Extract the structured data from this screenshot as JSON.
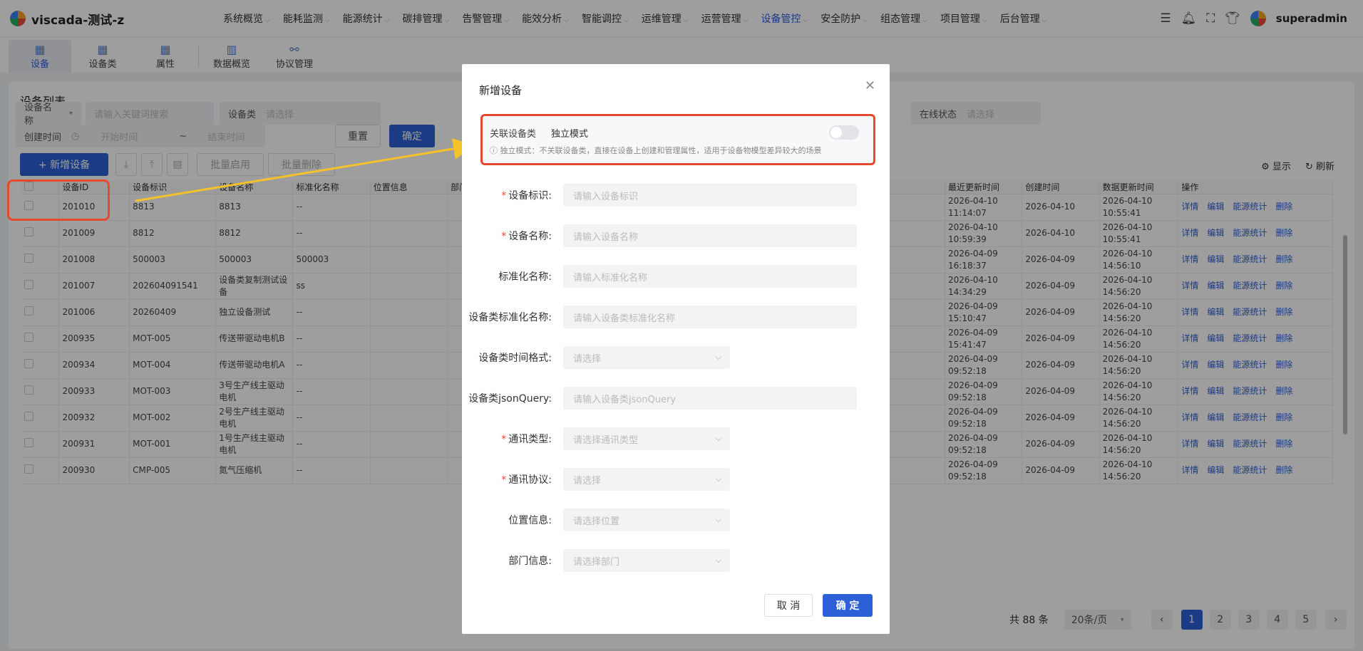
{
  "app": {
    "title": "viscada-测试-z",
    "user": "superadmin"
  },
  "topnav": [
    "系统概览",
    "能耗监测",
    "能源统计",
    "碳排管理",
    "告警管理",
    "能效分析",
    "智能调控",
    "运维管理",
    "运营管理",
    "设备管控",
    "安全防护",
    "组态管理",
    "项目管理",
    "后台管理"
  ],
  "subnav": [
    "设备",
    "设备类",
    "属性",
    "数据概览",
    "协议管理"
  ],
  "panel": {
    "title": "设备列表",
    "filters": {
      "device_name_label": "设备名称",
      "keyword_placeholder": "请输入关键词搜索",
      "device_class_label": "设备类",
      "device_class_placeholder": "请选择",
      "created_label": "创建时间",
      "start_placeholder": "开始时间",
      "range_sep": "~",
      "end_placeholder": "结束时间",
      "online_label": "在线状态",
      "online_placeholder": "请选择",
      "reset": "重置",
      "confirm": "确定"
    },
    "actions": {
      "add": "+ 新增设备",
      "batch_enable": "批量启用",
      "batch_delete": "批量删除",
      "display": "显示",
      "refresh": "刷新"
    },
    "columns": [
      "设备ID",
      "设备标识",
      "设备名称",
      "标准化名称",
      "位置信息",
      "部门",
      "最近更新时间",
      "创建时间",
      "数据更新时间",
      "操作"
    ],
    "row_ops": [
      "详情",
      "编辑",
      "能源统计",
      "删除"
    ],
    "rows": [
      {
        "id": "201010",
        "key": "8813",
        "name": "8813",
        "std": "--",
        "recent": "2026-04-10 11:14:07",
        "created": "2026-04-10",
        "data": "2026-04-10 10:55:41"
      },
      {
        "id": "201009",
        "key": "8812",
        "name": "8812",
        "std": "--",
        "recent": "2026-04-10 10:59:39",
        "created": "2026-04-10",
        "data": "2026-04-10 10:55:41"
      },
      {
        "id": "201008",
        "key": "500003",
        "name": "500003",
        "std": "500003",
        "recent": "2026-04-09 16:18:37",
        "created": "2026-04-09",
        "data": "2026-04-10 14:56:10"
      },
      {
        "id": "201007",
        "key": "202604091541",
        "name": "设备类复制测试设备",
        "std": "ss",
        "recent": "2026-04-10 14:34:29",
        "created": "2026-04-09",
        "data": "2026-04-10 14:56:20"
      },
      {
        "id": "201006",
        "key": "20260409",
        "name": "独立设备测试",
        "std": "--",
        "recent": "2026-04-09 15:10:47",
        "created": "2026-04-09",
        "data": "2026-04-10 14:56:20"
      },
      {
        "id": "200935",
        "key": "MOT-005",
        "name": "传送带驱动电机B",
        "std": "--",
        "recent": "2026-04-09 15:41:47",
        "created": "2026-04-09",
        "data": "2026-04-10 14:56:20"
      },
      {
        "id": "200934",
        "key": "MOT-004",
        "name": "传送带驱动电机A",
        "std": "--",
        "recent": "2026-04-09 09:52:18",
        "created": "2026-04-09",
        "data": "2026-04-10 14:56:20"
      },
      {
        "id": "200933",
        "key": "MOT-003",
        "name": "3号生产线主驱动电机",
        "std": "--",
        "recent": "2026-04-09 09:52:18",
        "created": "2026-04-09",
        "data": "2026-04-10 14:56:20"
      },
      {
        "id": "200932",
        "key": "MOT-002",
        "name": "2号生产线主驱动电机",
        "std": "--",
        "recent": "2026-04-09 09:52:18",
        "created": "2026-04-09",
        "data": "2026-04-10 14:56:20"
      },
      {
        "id": "200931",
        "key": "MOT-001",
        "name": "1号生产线主驱动电机",
        "std": "--",
        "recent": "2026-04-09 09:52:18",
        "created": "2026-04-09",
        "data": "2026-04-10 14:56:20"
      },
      {
        "id": "200930",
        "key": "CMP-005",
        "name": "氮气压缩机",
        "std": "--",
        "recent": "2026-04-09 09:52:18",
        "created": "2026-04-09",
        "data": "2026-04-10 14:56:20"
      }
    ],
    "pagination": {
      "total": "共 88 条",
      "page_size": "20条/页",
      "pages": [
        "1",
        "2",
        "3",
        "4",
        "5"
      ],
      "current": "1"
    }
  },
  "modal": {
    "title": "新增设备",
    "mode_label": "关联设备类",
    "mode_value": "独立模式",
    "mode_tip": "独立模式：不关联设备类，直接在设备上创建和管理属性，适用于设备物模型差异较大的场景",
    "fields": [
      {
        "label": "设备标识:",
        "required": true,
        "placeholder": "请输入设备标识",
        "kind": "text"
      },
      {
        "label": "设备名称:",
        "required": true,
        "placeholder": "请输入设备名称",
        "kind": "text"
      },
      {
        "label": "标准化名称:",
        "required": false,
        "placeholder": "请输入标准化名称",
        "kind": "text"
      },
      {
        "label": "设备类标准化名称:",
        "required": false,
        "placeholder": "请输入设备类标准化名称",
        "kind": "text"
      },
      {
        "label": "设备类时间格式:",
        "required": false,
        "placeholder": "请选择",
        "kind": "select"
      },
      {
        "label": "设备类jsonQuery:",
        "required": false,
        "placeholder": "请输入设备类jsonQuery",
        "kind": "text"
      },
      {
        "label": "通讯类型:",
        "required": true,
        "placeholder": "请选择通讯类型",
        "kind": "select"
      },
      {
        "label": "通讯协议:",
        "required": true,
        "placeholder": "请选择",
        "kind": "select"
      },
      {
        "label": "位置信息:",
        "required": false,
        "placeholder": "请选择位置",
        "kind": "select"
      },
      {
        "label": "部门信息:",
        "required": false,
        "placeholder": "请选择部门",
        "kind": "select"
      }
    ],
    "cancel": "取 消",
    "ok": "确 定"
  }
}
